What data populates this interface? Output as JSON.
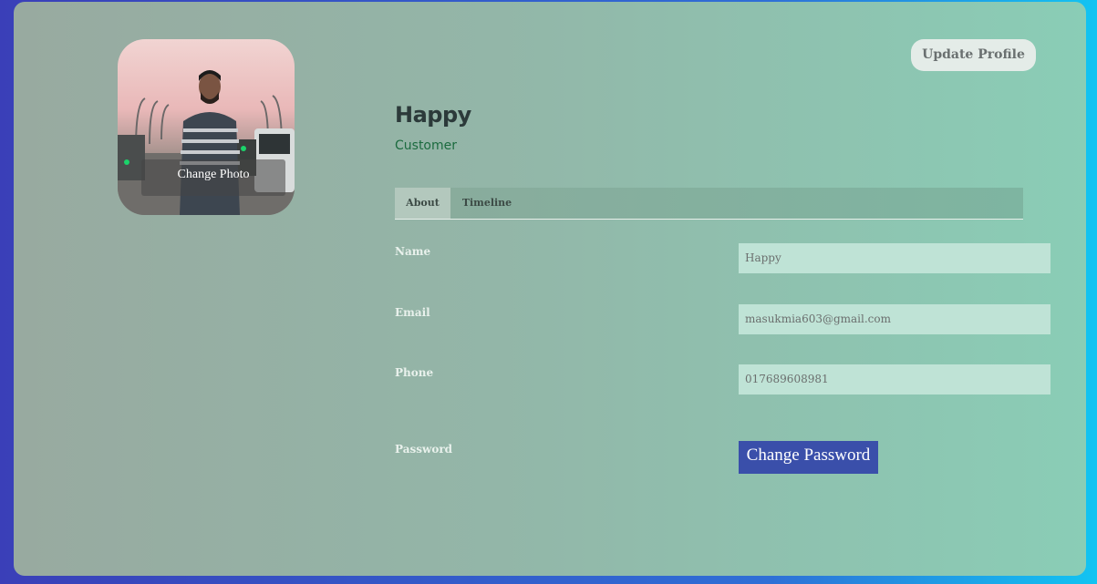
{
  "profile": {
    "change_photo_label": "Change Photo",
    "update_label": "Update Profile",
    "name": "Happy",
    "role": "Customer"
  },
  "tabs": [
    {
      "label": "About",
      "active": true
    },
    {
      "label": "Timeline",
      "active": false
    }
  ],
  "fields": {
    "name": {
      "label": "Name",
      "value": "Happy"
    },
    "email": {
      "label": "Email",
      "value": "masukmia603@gmail.com"
    },
    "phone": {
      "label": "Phone",
      "value": "017689608981"
    },
    "password": {
      "label": "Password",
      "button_label": "Change Password"
    }
  },
  "colors": {
    "accent_button": "#3a4faa",
    "role_text": "#1c6b3f",
    "field_bg": "#bfe3d6"
  }
}
